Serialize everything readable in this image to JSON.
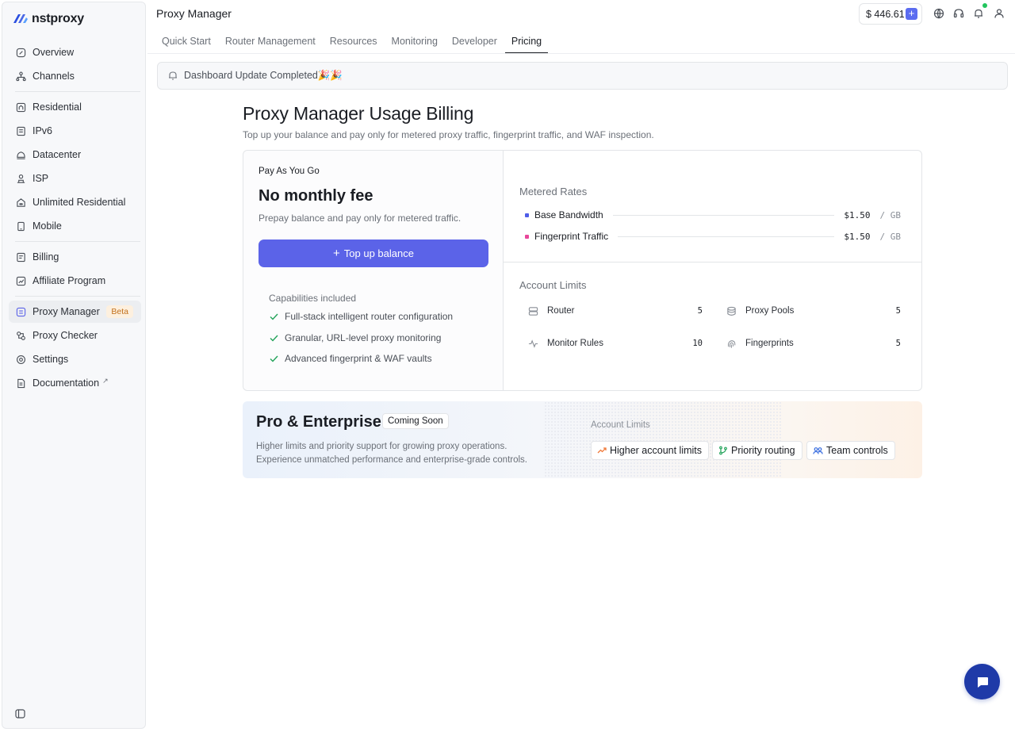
{
  "brand": {
    "name": "nstproxy"
  },
  "sidebar": {
    "items": [
      {
        "label": "Overview",
        "icon": "gauge-icon"
      },
      {
        "label": "Channels",
        "icon": "network-icon"
      },
      {
        "label": "Residential",
        "icon": "home-icon"
      },
      {
        "label": "IPv6",
        "icon": "server-icon"
      },
      {
        "label": "Datacenter",
        "icon": "database-icon"
      },
      {
        "label": "ISP",
        "icon": "isp-icon"
      },
      {
        "label": "Unlimited Residential",
        "icon": "infinity-home-icon"
      },
      {
        "label": "Mobile",
        "icon": "mobile-icon"
      },
      {
        "label": "Billing",
        "icon": "billing-icon"
      },
      {
        "label": "Affiliate Program",
        "icon": "affiliate-icon"
      },
      {
        "label": "Proxy Manager",
        "icon": "proxy-manager-icon",
        "badge": "Beta"
      },
      {
        "label": "Proxy Checker",
        "icon": "checker-icon"
      },
      {
        "label": "Settings",
        "icon": "gear-icon"
      },
      {
        "label": "Documentation",
        "icon": "document-icon",
        "suffix": "↗"
      }
    ]
  },
  "header": {
    "title": "Proxy Manager",
    "balance": "$ 446.61",
    "tabs": [
      "Quick Start",
      "Router Management",
      "Resources",
      "Monitoring",
      "Developer",
      "Pricing"
    ],
    "active_tab": "Pricing"
  },
  "banner": {
    "text": "Dashboard Update Completed🎉🎉"
  },
  "main": {
    "title": "Proxy Manager Usage Billing",
    "subtitle": "Top up your balance and pay only for metered proxy traffic, fingerprint traffic, and WAF inspection.",
    "plan": {
      "label": "Pay As You Go",
      "headline": "No monthly fee",
      "desc": "Prepay balance and pay only for metered traffic.",
      "button": "Top up balance",
      "capabilities_title": "Capabilities included",
      "capabilities": [
        "Full-stack intelligent router configuration",
        "Granular, URL-level proxy monitoring",
        "Advanced fingerprint & WAF vaults"
      ]
    },
    "rates": {
      "title": "Metered Rates",
      "items": [
        {
          "name": "Base Bandwidth",
          "price": "$1.50",
          "unit": "/ GB",
          "color": "#4f5de8"
        },
        {
          "name": "Fingerprint Traffic",
          "price": "$1.50",
          "unit": "/ GB",
          "color": "#e8479a"
        }
      ]
    },
    "limits": {
      "title": "Account Limits",
      "items": [
        {
          "name": "Router",
          "value": "5",
          "icon": "router-icon"
        },
        {
          "name": "Proxy Pools",
          "value": "5",
          "icon": "database-icon"
        },
        {
          "name": "Monitor Rules",
          "value": "10",
          "icon": "activity-icon"
        },
        {
          "name": "Fingerprints",
          "value": "5",
          "icon": "fingerprint-icon"
        }
      ]
    },
    "pro": {
      "title": "Pro & Enterprise",
      "badge": "Coming Soon",
      "desc_line1": "Higher limits and priority support for growing proxy operations.",
      "desc_line2": "Experience unmatched performance and enterprise-grade controls.",
      "limits_label": "Account Limits",
      "chips": [
        {
          "label": "Higher account limits",
          "icon": "trend-up-icon",
          "color": "#f07a3a"
        },
        {
          "label": "Priority routing",
          "icon": "git-branch-icon",
          "color": "#22a35a"
        },
        {
          "label": "Team controls",
          "icon": "users-icon",
          "color": "#3b6fe0"
        }
      ]
    }
  }
}
